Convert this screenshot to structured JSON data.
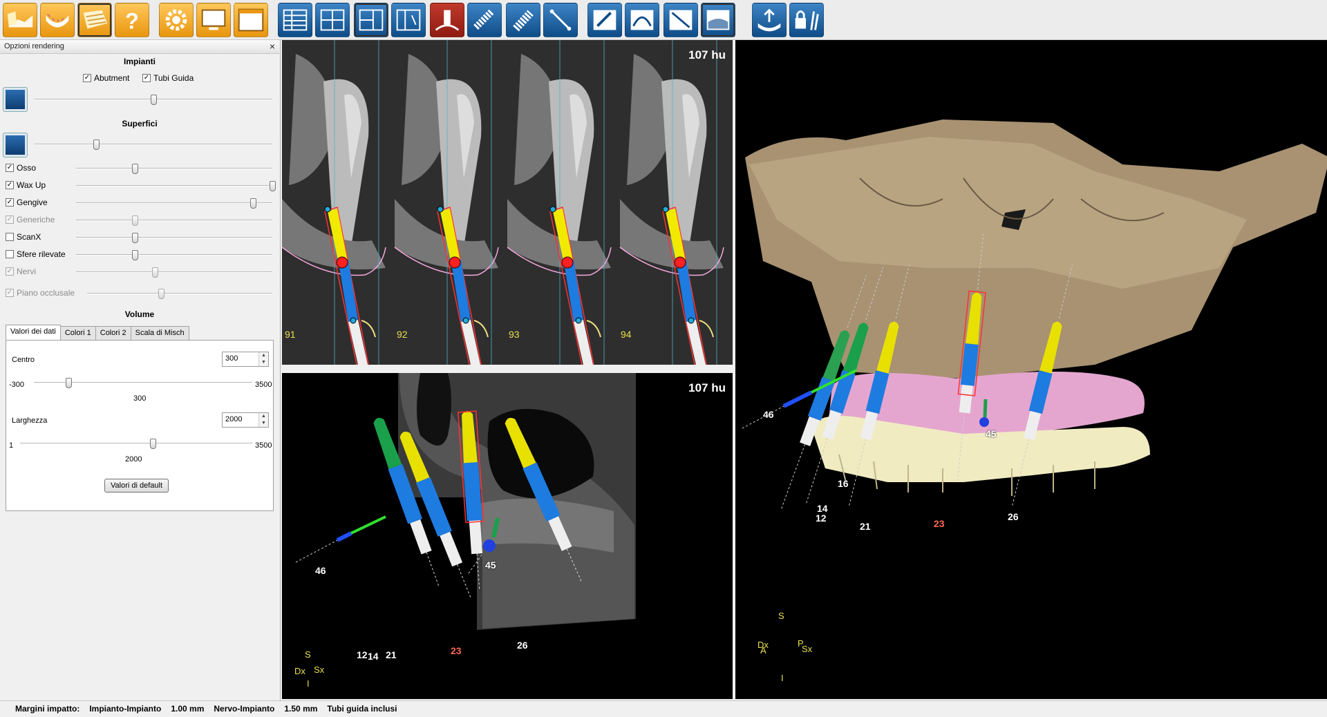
{
  "toolbar": {
    "buttons": [
      {
        "icon": "open-scan-icon",
        "color": "orange"
      },
      {
        "icon": "jaw-icon",
        "color": "orange"
      },
      {
        "icon": "bone-icon",
        "color": "orange",
        "selected": true
      },
      {
        "icon": "help-icon",
        "color": "orange"
      },
      {
        "icon": "settings-gear-icon",
        "color": "orange"
      },
      {
        "icon": "monitor-icon",
        "color": "orange"
      },
      {
        "icon": "window-icon",
        "color": "orange"
      },
      {
        "icon": "layout-list-icon",
        "color": "blue"
      },
      {
        "icon": "layout-grid-icon",
        "color": "blue"
      },
      {
        "icon": "layout-split-icon",
        "color": "blue",
        "selected": true
      },
      {
        "icon": "layout-mpr-icon",
        "color": "blue"
      },
      {
        "icon": "implant-red-icon",
        "color": "red"
      },
      {
        "icon": "implant-screw-icon",
        "color": "blue"
      },
      {
        "icon": "screw-icon",
        "color": "blue"
      },
      {
        "icon": "measure-line-icon",
        "color": "blue"
      },
      {
        "icon": "draw-edit-icon",
        "color": "blue"
      },
      {
        "icon": "curve-icon",
        "color": "blue"
      },
      {
        "icon": "panoramic-icon",
        "color": "blue"
      },
      {
        "icon": "surface-icon",
        "color": "blue",
        "selected": true
      },
      {
        "icon": "export-tray-icon",
        "color": "blue"
      },
      {
        "icon": "lock-tools-icon",
        "color": "blue"
      }
    ]
  },
  "panel": {
    "title": "Opzioni rendering",
    "close": "×",
    "implants": {
      "header": "Impianti",
      "abutment": "Abutment",
      "guide_tubes": "Tubi Guida",
      "opacity": 0.5
    },
    "surfaces": {
      "header": "Superfici",
      "master_opacity": 0.3,
      "items": [
        {
          "label": "Osso",
          "checked": true,
          "disabled": false,
          "value": 0.3
        },
        {
          "label": "Wax Up",
          "checked": true,
          "disabled": false,
          "value": 1.0
        },
        {
          "label": "Gengive",
          "checked": true,
          "disabled": false,
          "value": 0.9
        },
        {
          "label": "Generiche",
          "checked": true,
          "disabled": true,
          "value": 0.3
        },
        {
          "label": "ScanX",
          "checked": false,
          "disabled": false,
          "value": 0.3
        },
        {
          "label": "Sfere rilevate",
          "checked": false,
          "disabled": false,
          "value": 0.3
        },
        {
          "label": "Nervi",
          "checked": true,
          "disabled": true,
          "value": 0.4
        }
      ],
      "occlusal": {
        "label": "Piano occlusale",
        "checked": true,
        "disabled": true,
        "value": 0.4
      }
    },
    "volume": {
      "header": "Volume",
      "tabs": [
        "Valori dei dati",
        "Colori 1",
        "Colori 2",
        "Scala di Misch"
      ],
      "centro_label": "Centro",
      "centro_value": "300",
      "centro_min": "-300",
      "centro_max": "3500",
      "centro_current": "300",
      "centro_pos": 0.157,
      "larghezza_label": "Larghezza",
      "larghezza_value": "2000",
      "larghezza_min": "1",
      "larghezza_max": "3500",
      "larghezza_current": "2000",
      "larghezza_pos": 0.571,
      "default_button": "Valori di default"
    }
  },
  "views": {
    "cross_hu": "107 hu",
    "slice_numbers": [
      "91",
      "92",
      "93",
      "94"
    ],
    "axial_hu": "107 hu",
    "axial_labels": [
      "46",
      "45",
      "12",
      "14",
      "21",
      "23",
      "26"
    ],
    "axial_orient": {
      "s": "S",
      "dx": "Dx",
      "sx": "Sx",
      "i": "I"
    },
    "model_labels": [
      "46",
      "45",
      "16",
      "14",
      "12",
      "21",
      "23",
      "26"
    ],
    "model_orient": {
      "s": "S",
      "dx": "Dx",
      "a": "A",
      "p": "P",
      "sx": "Sx",
      "i": "I"
    }
  },
  "status": {
    "margins_label": "Margini impatto:",
    "impl_impl_label": "Impianto-Impianto",
    "impl_impl_value": "1.00 mm",
    "nerve_label": "Nervo-Impianto",
    "nerve_value": "1.50 mm",
    "tubes": "Tubi guida inclusi"
  }
}
